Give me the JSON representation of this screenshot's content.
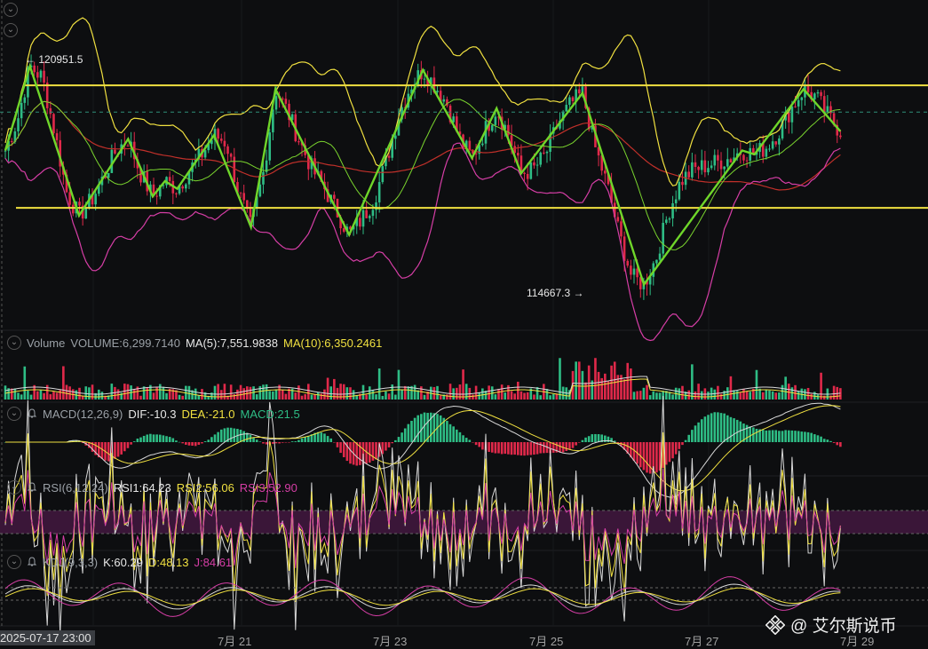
{
  "chart_data": {
    "type": "candlestick",
    "symbol_panels": [
      "price",
      "volume",
      "macd",
      "rsi",
      "kdj"
    ],
    "x_ticks": [
      "7月 21",
      "7月 23",
      "7月 25",
      "7月 27",
      "7月 29"
    ],
    "cursor_date": "2025-07-17 23:00",
    "price": {
      "high_marker": "120951.5",
      "low_marker": "114667.3",
      "ylim": [
        114100,
        121400
      ],
      "close_series": [
        118400,
        119200,
        120600,
        120300,
        118900,
        117300,
        116700,
        117100,
        117700,
        118400,
        118700,
        117800,
        117200,
        117600,
        117400,
        117900,
        118300,
        118800,
        118600,
        117300,
        116400,
        117800,
        120000,
        119400,
        118600,
        117900,
        117400,
        116800,
        116200,
        116600,
        117100,
        118100,
        119300,
        120100,
        120500,
        120100,
        119600,
        118700,
        118200,
        118900,
        119500,
        118800,
        117800,
        117900,
        118300,
        119100,
        119600,
        119900,
        118500,
        117500,
        116200,
        115100,
        114900,
        115600,
        116800,
        117600,
        117900,
        118000,
        118100,
        118200,
        118400,
        118300,
        118500,
        118900,
        119500,
        120000,
        119800,
        119300,
        118900
      ],
      "horizontal_levels": [
        120100,
        116900
      ],
      "dashed_level": 119400
    },
    "volume": {
      "label": "Volume",
      "volume": "VOLUME:6,299.7140",
      "ma5": "MA(5):7,551.9838",
      "ma10": "MA(10):6,350.2461"
    },
    "macd": {
      "label": "MACD(12,26,9)",
      "dif": "DIF:-10.3",
      "dea": "DEA:-21.0",
      "macd": "MACD:21.5"
    },
    "rsi": {
      "label": "RSI(6,12,24)",
      "rsi1": "RSI1:64.23",
      "rsi2": "RSI2:56.06",
      "rsi3": "RSI3:52.90"
    },
    "kdj": {
      "label": "KDJ(9,3,3)",
      "k": "K:60.29",
      "d": "D:48.13",
      "j": "J:84.61"
    }
  },
  "watermark": "@ 艾尔斯说币",
  "colors": {
    "up": "#2ebd85",
    "down": "#e0294a",
    "yellow": "#f0e040",
    "green": "#7ad42e",
    "magenta": "#d63ea6",
    "red_ma": "#c0302a",
    "white_line": "#d8d8d8"
  }
}
